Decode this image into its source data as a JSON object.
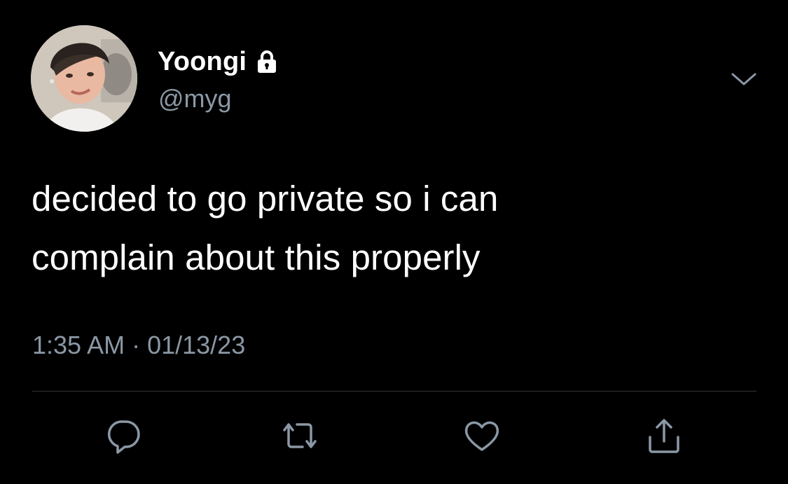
{
  "user": {
    "display_name": "Yoongi",
    "handle": "@myg",
    "protected_icon": "lock-icon",
    "avatar_icon": "profile-photo"
  },
  "tweet": {
    "text_lines": [
      "decided to go private so i can",
      "complain about this properly"
    ],
    "time": "1:35 AM",
    "separator": "·",
    "date": "01/13/23"
  },
  "menu": {
    "icon": "chevron-down-icon"
  },
  "actions": [
    {
      "name": "reply",
      "icon": "reply-icon"
    },
    {
      "name": "retweet",
      "icon": "retweet-icon"
    },
    {
      "name": "like",
      "icon": "heart-icon"
    },
    {
      "name": "share",
      "icon": "share-icon"
    }
  ],
  "colors": {
    "background": "#000000",
    "primary_text": "#ffffff",
    "secondary_text": "#8b98a5",
    "divider": "#2f3336"
  }
}
